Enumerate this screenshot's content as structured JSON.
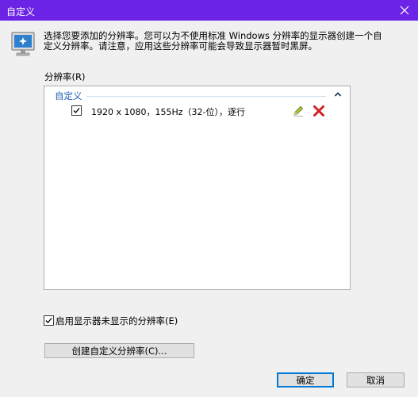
{
  "window": {
    "title": "自定义"
  },
  "intro": {
    "line1": "选择您要添加的分辨率。您可以为不使用标准 Windows 分辨率的显示器创建一个自",
    "line2": "定义分辨率。请注意，应用这些分辨率可能会导致显示器暂时黑屏。"
  },
  "resolution_list": {
    "label": "分辨率(R)",
    "group": "自定义",
    "items": [
      {
        "text": "1920 x 1080，155Hz（32-位），逐行",
        "checked": true
      }
    ]
  },
  "enable_unexposed": {
    "label": "启用显示器未显示的分辨率(E)",
    "checked": true
  },
  "buttons": {
    "create": "创建自定义分辨率(C)...",
    "ok": "确定",
    "cancel": "取消"
  },
  "colors": {
    "titlebar": "#6b24e6",
    "group_header": "#1e5fb4",
    "delete": "#d11f1f"
  },
  "icons": [
    "monitor-icon",
    "close-icon",
    "chevron-up-icon",
    "pencil-icon",
    "delete-x-icon",
    "checkmark-icon"
  ]
}
